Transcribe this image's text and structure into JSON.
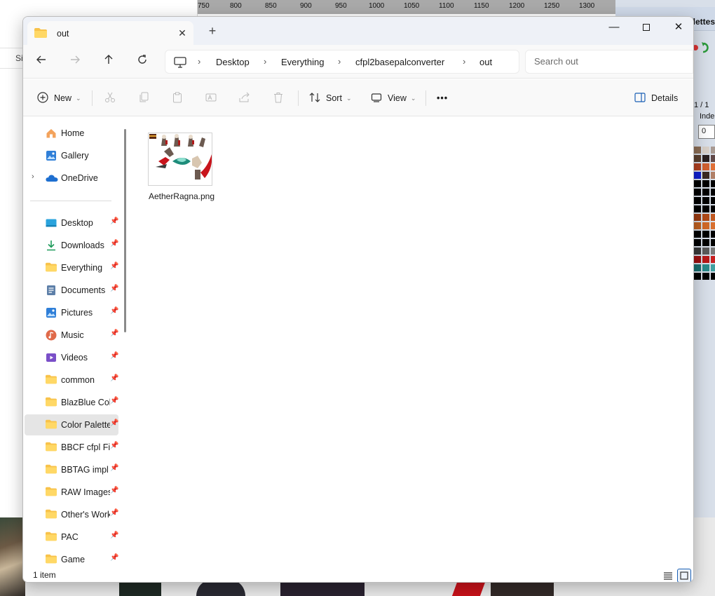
{
  "background": {
    "left_strip_text": "Si",
    "ruler_labels": [
      "750",
      "800",
      "850",
      "900",
      "950",
      "1000",
      "1050",
      "1100",
      "1150",
      "1200",
      "1250",
      "1300"
    ],
    "right_panel_title": "lettes",
    "right_page_label": "1 / 1",
    "right_index_label": "Inde",
    "right_index_value": "0"
  },
  "window": {
    "tab_title": "out",
    "tab_close_icon": "close-icon",
    "new_tab_icon": "plus-icon",
    "controls": {
      "minimize": "minimize-icon",
      "maximize": "maximize-icon",
      "close": "close-icon"
    }
  },
  "address": {
    "root_icon": "this-pc-icon",
    "crumbs": [
      "Desktop",
      "Everything",
      "cfpl2basepalconverter",
      "out"
    ],
    "search_placeholder": "Search out"
  },
  "commands": {
    "new": "New",
    "sort": "Sort",
    "view": "View",
    "more": "•••",
    "details": "Details"
  },
  "sidebar": {
    "home": "Home",
    "gallery": "Gallery",
    "onedrive": "OneDrive",
    "pinned": [
      "Desktop",
      "Downloads",
      "Everything",
      "Documents",
      "Pictures",
      "Music",
      "Videos",
      "common",
      "BlazBlue Colo",
      "Color Palette",
      "BBCF cfpl Fil",
      "BBTAG impl F",
      "RAW Images",
      "Other's Work",
      "PAC",
      "Game"
    ],
    "selected": "Color Palette"
  },
  "content": {
    "files": [
      {
        "name": "AetherRagna.png"
      }
    ]
  },
  "status": {
    "item_count": "1 item"
  },
  "colors": {
    "accent": "#1a5fb4",
    "folder": "#f8c24a",
    "onedrive": "#1e6fd0"
  }
}
